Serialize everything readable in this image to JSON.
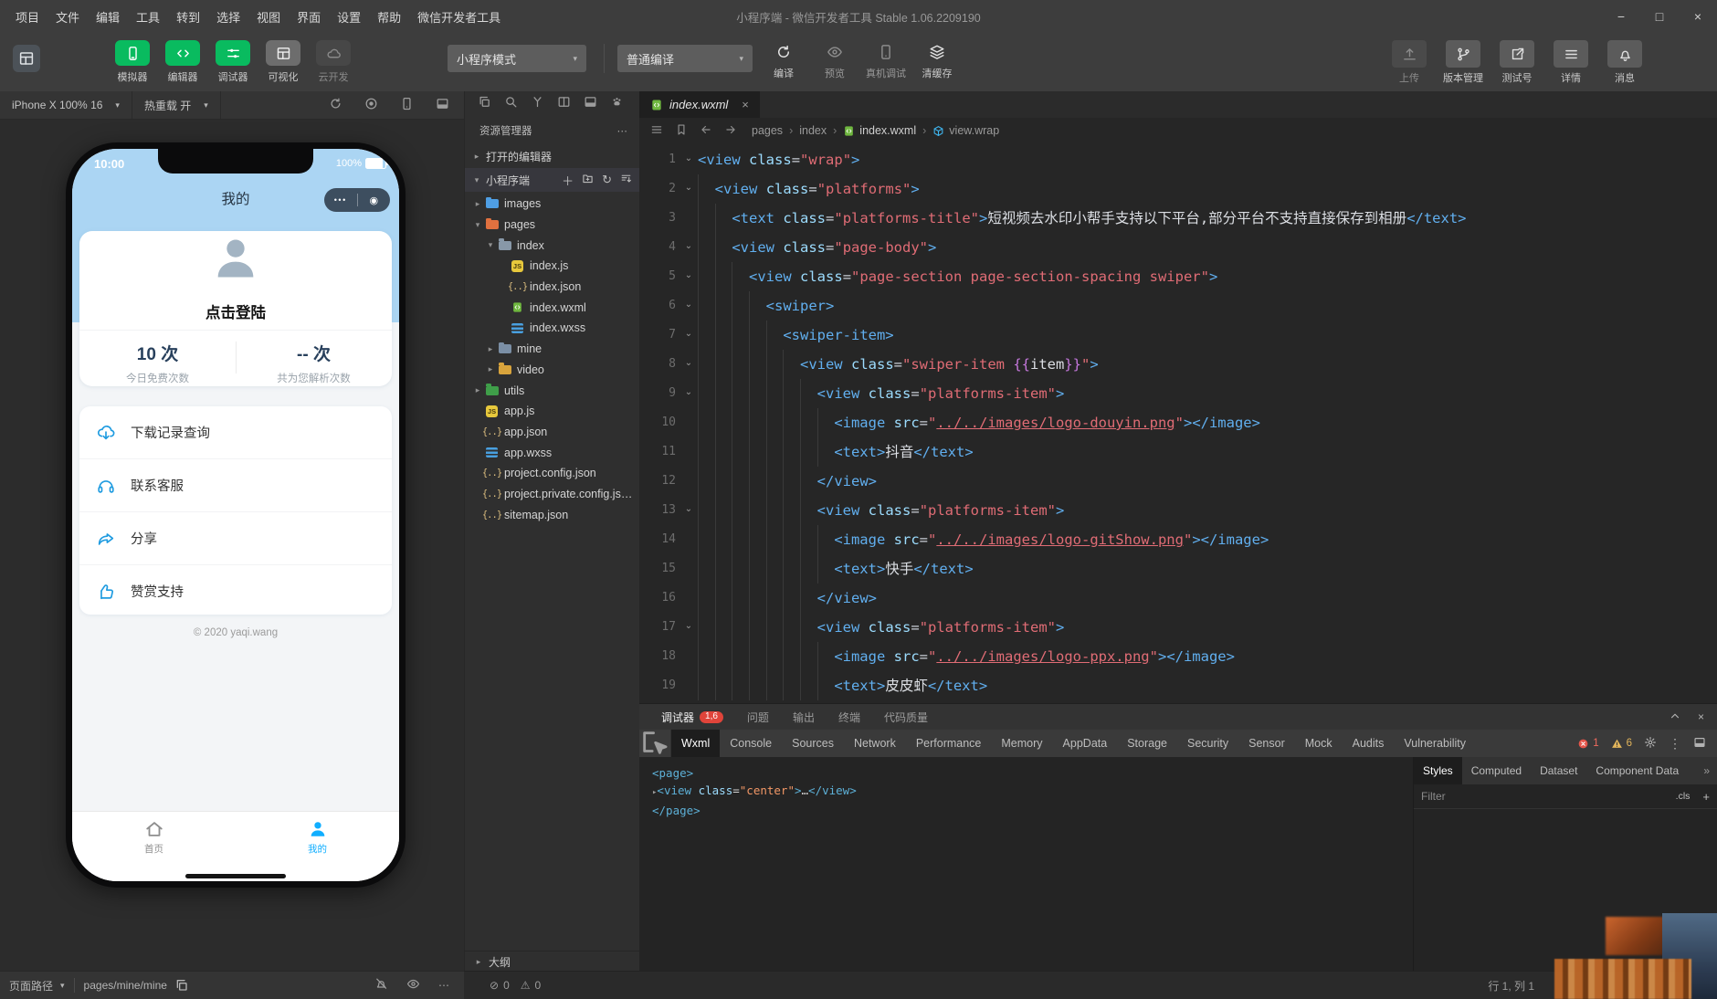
{
  "window": {
    "menu": [
      "项目",
      "文件",
      "编辑",
      "工具",
      "转到",
      "选择",
      "视图",
      "界面",
      "设置",
      "帮助",
      "微信开发者工具"
    ],
    "title": "小程序端 - 微信开发者工具 Stable 1.06.2209190",
    "controls": {
      "minimize": "−",
      "maximize": "□",
      "close": "×"
    }
  },
  "toolbar": {
    "toggles": [
      {
        "label": "模拟器",
        "icon": "phone",
        "state": "on"
      },
      {
        "label": "编辑器",
        "icon": "code",
        "state": "on"
      },
      {
        "label": "调试器",
        "icon": "sliders",
        "state": "on"
      },
      {
        "label": "可视化",
        "icon": "grid",
        "state": "neutral"
      },
      {
        "label": "云开发",
        "icon": "cloud",
        "state": "dim"
      }
    ],
    "mode_select": "小程序模式",
    "compile_select": "普通编译",
    "actions": [
      {
        "label": "编译",
        "icon": "refresh",
        "dim": false
      },
      {
        "label": "预览",
        "icon": "eye",
        "dim": true
      },
      {
        "label": "真机调试",
        "icon": "device",
        "dim": true
      },
      {
        "label": "清缓存",
        "icon": "stack",
        "dim": false
      }
    ],
    "right_actions": [
      {
        "label": "上传",
        "icon": "upload",
        "dim": true
      },
      {
        "label": "版本管理",
        "icon": "branch",
        "dim": false
      },
      {
        "label": "测试号",
        "icon": "external",
        "dim": false
      },
      {
        "label": "详情",
        "icon": "bars",
        "dim": false
      },
      {
        "label": "消息",
        "icon": "bell",
        "dim": false
      }
    ],
    "accent_green": "#09bb5f"
  },
  "simulator": {
    "bar": {
      "device": "iPhone X 100% 16",
      "hot_reload": "热重载 开"
    },
    "statusbar": {
      "time": "10:00",
      "battery": "100%"
    },
    "nav_title": "我的",
    "capsule": {
      "dots": "•••",
      "circle": "◉"
    },
    "profile": {
      "login": "点击登陆"
    },
    "stats": [
      {
        "value": "10 次",
        "label": "今日免费次数"
      },
      {
        "value": "-- 次",
        "label": "共为您解析次数"
      }
    ],
    "menu": [
      {
        "icon": "clouddown",
        "label": "下载记录查询"
      },
      {
        "icon": "headset",
        "label": "联系客服"
      },
      {
        "icon": "share",
        "label": "分享"
      },
      {
        "icon": "thumb",
        "label": "赞赏支持"
      }
    ],
    "copyright": "© 2020 yaqi.wang",
    "tabbar": [
      {
        "icon": "home",
        "label": "首页",
        "active": false
      },
      {
        "icon": "person",
        "label": "我的",
        "active": true
      }
    ],
    "footer": {
      "path_label": "页面路径",
      "path": "pages/mine/mine"
    },
    "accent_blue": "#10aeff"
  },
  "explorer": {
    "title": "资源管理器",
    "sections": [
      {
        "label": "打开的编辑器",
        "expanded": false
      },
      {
        "label": "小程序端",
        "expanded": true
      }
    ],
    "tree": [
      {
        "name": "images",
        "icon": "folder-images",
        "level": 1,
        "arrow": "right"
      },
      {
        "name": "pages",
        "icon": "folder-pages",
        "level": 1,
        "arrow": "down"
      },
      {
        "name": "index",
        "icon": "folder-open",
        "level": 2,
        "arrow": "down"
      },
      {
        "name": "index.js",
        "icon": "js",
        "level": 3,
        "arrow": ""
      },
      {
        "name": "index.json",
        "icon": "json",
        "level": 3,
        "arrow": ""
      },
      {
        "name": "index.wxml",
        "icon": "wxml",
        "level": 3,
        "arrow": ""
      },
      {
        "name": "index.wxss",
        "icon": "wxss",
        "level": 3,
        "arrow": ""
      },
      {
        "name": "mine",
        "icon": "folder",
        "level": 2,
        "arrow": "right"
      },
      {
        "name": "video",
        "icon": "folder-video",
        "level": 2,
        "arrow": "right"
      },
      {
        "name": "utils",
        "icon": "folder-utils",
        "level": 1,
        "arrow": "right"
      },
      {
        "name": "app.js",
        "icon": "js",
        "level": 1,
        "arrow": ""
      },
      {
        "name": "app.json",
        "icon": "json",
        "level": 1,
        "arrow": ""
      },
      {
        "name": "app.wxss",
        "icon": "wxss",
        "level": 1,
        "arrow": ""
      },
      {
        "name": "project.config.json",
        "icon": "json",
        "level": 1,
        "arrow": ""
      },
      {
        "name": "project.private.config.js…",
        "icon": "json",
        "level": 1,
        "arrow": ""
      },
      {
        "name": "sitemap.json",
        "icon": "json",
        "level": 1,
        "arrow": ""
      }
    ],
    "outline": "大纲"
  },
  "editor": {
    "tab": "index.wxml",
    "breadcrumb": [
      {
        "label": "pages",
        "icon": ""
      },
      {
        "label": "index",
        "icon": ""
      },
      {
        "label": "index.wxml",
        "icon": "wxmlfile"
      },
      {
        "label": "view.wrap",
        "icon": "cube"
      }
    ],
    "lines": [
      {
        "n": 1,
        "ind": 0,
        "fold": true,
        "tk": [
          [
            "t",
            "<view"
          ],
          [
            "o",
            " "
          ],
          [
            "a",
            "class"
          ],
          [
            "o",
            "="
          ],
          [
            "s",
            "\"wrap\""
          ],
          [
            "t",
            ">"
          ]
        ]
      },
      {
        "n": 2,
        "ind": 1,
        "fold": true,
        "tk": [
          [
            "t",
            "<view"
          ],
          [
            "o",
            " "
          ],
          [
            "a",
            "class"
          ],
          [
            "o",
            "="
          ],
          [
            "s",
            "\"platforms\""
          ],
          [
            "t",
            ">"
          ]
        ]
      },
      {
        "n": 3,
        "ind": 2,
        "fold": false,
        "tk": [
          [
            "t",
            "<text"
          ],
          [
            "o",
            " "
          ],
          [
            "a",
            "class"
          ],
          [
            "o",
            "="
          ],
          [
            "s",
            "\"platforms-title\""
          ],
          [
            "t",
            ">"
          ],
          [
            "x",
            "短视频去水印小帮手支持以下平台,部分平台不支持直接保存到相册"
          ],
          [
            "t",
            "</text>"
          ]
        ]
      },
      {
        "n": 4,
        "ind": 2,
        "fold": true,
        "tk": [
          [
            "t",
            "<view"
          ],
          [
            "o",
            " "
          ],
          [
            "a",
            "class"
          ],
          [
            "o",
            "="
          ],
          [
            "s",
            "\"page-body\""
          ],
          [
            "t",
            ">"
          ]
        ]
      },
      {
        "n": 5,
        "ind": 3,
        "fold": true,
        "tk": [
          [
            "t",
            "<view"
          ],
          [
            "o",
            " "
          ],
          [
            "a",
            "class"
          ],
          [
            "o",
            "="
          ],
          [
            "s",
            "\"page-section page-section-spacing swiper\""
          ],
          [
            "t",
            ">"
          ]
        ]
      },
      {
        "n": 6,
        "ind": 4,
        "fold": true,
        "tk": [
          [
            "t",
            "<swiper>"
          ]
        ]
      },
      {
        "n": 7,
        "ind": 5,
        "fold": true,
        "tk": [
          [
            "t",
            "<swiper-item>"
          ]
        ]
      },
      {
        "n": 8,
        "ind": 6,
        "fold": true,
        "tk": [
          [
            "t",
            "<view"
          ],
          [
            "o",
            " "
          ],
          [
            "a",
            "class"
          ],
          [
            "o",
            "="
          ],
          [
            "s",
            "\"swiper-item "
          ],
          [
            "b",
            "{{"
          ],
          [
            "x",
            "item"
          ],
          [
            "b",
            "}}"
          ],
          [
            "s",
            "\""
          ],
          [
            "t",
            ">"
          ]
        ]
      },
      {
        "n": 9,
        "ind": 7,
        "fold": true,
        "tk": [
          [
            "t",
            "<view"
          ],
          [
            "o",
            " "
          ],
          [
            "a",
            "class"
          ],
          [
            "o",
            "="
          ],
          [
            "s",
            "\"platforms-item\""
          ],
          [
            "t",
            ">"
          ]
        ]
      },
      {
        "n": 10,
        "ind": 8,
        "fold": false,
        "tk": [
          [
            "t",
            "<image"
          ],
          [
            "o",
            " "
          ],
          [
            "a",
            "src"
          ],
          [
            "o",
            "="
          ],
          [
            "s",
            "\""
          ],
          [
            "u",
            "../../images/logo-douyin.png"
          ],
          [
            "s",
            "\""
          ],
          [
            "t",
            "></image>"
          ]
        ]
      },
      {
        "n": 11,
        "ind": 8,
        "fold": false,
        "tk": [
          [
            "t",
            "<text>"
          ],
          [
            "x",
            "抖音"
          ],
          [
            "t",
            "</text>"
          ]
        ]
      },
      {
        "n": 12,
        "ind": 7,
        "fold": false,
        "tk": [
          [
            "t",
            "</view>"
          ]
        ]
      },
      {
        "n": 13,
        "ind": 7,
        "fold": true,
        "tk": [
          [
            "t",
            "<view"
          ],
          [
            "o",
            " "
          ],
          [
            "a",
            "class"
          ],
          [
            "o",
            "="
          ],
          [
            "s",
            "\"platforms-item\""
          ],
          [
            "t",
            ">"
          ]
        ]
      },
      {
        "n": 14,
        "ind": 8,
        "fold": false,
        "tk": [
          [
            "t",
            "<image"
          ],
          [
            "o",
            " "
          ],
          [
            "a",
            "src"
          ],
          [
            "o",
            "="
          ],
          [
            "s",
            "\""
          ],
          [
            "u",
            "../../images/logo-gitShow.png"
          ],
          [
            "s",
            "\""
          ],
          [
            "t",
            "></image>"
          ]
        ]
      },
      {
        "n": 15,
        "ind": 8,
        "fold": false,
        "tk": [
          [
            "t",
            "<text>"
          ],
          [
            "x",
            "快手"
          ],
          [
            "t",
            "</text>"
          ]
        ]
      },
      {
        "n": 16,
        "ind": 7,
        "fold": false,
        "tk": [
          [
            "t",
            "</view>"
          ]
        ]
      },
      {
        "n": 17,
        "ind": 7,
        "fold": true,
        "tk": [
          [
            "t",
            "<view"
          ],
          [
            "o",
            " "
          ],
          [
            "a",
            "class"
          ],
          [
            "o",
            "="
          ],
          [
            "s",
            "\"platforms-item\""
          ],
          [
            "t",
            ">"
          ]
        ]
      },
      {
        "n": 18,
        "ind": 8,
        "fold": false,
        "tk": [
          [
            "t",
            "<image"
          ],
          [
            "o",
            " "
          ],
          [
            "a",
            "src"
          ],
          [
            "o",
            "="
          ],
          [
            "s",
            "\""
          ],
          [
            "u",
            "../../images/logo-ppx.png"
          ],
          [
            "s",
            "\""
          ],
          [
            "t",
            "></image>"
          ]
        ]
      },
      {
        "n": 19,
        "ind": 8,
        "fold": false,
        "tk": [
          [
            "t",
            "<text>"
          ],
          [
            "x",
            "皮皮虾"
          ],
          [
            "t",
            "</text>"
          ]
        ]
      }
    ]
  },
  "debugger": {
    "bar_tabs": [
      "调试器",
      "问题",
      "输出",
      "终端",
      "代码质量"
    ],
    "badge": "1,6",
    "devtools_tabs": [
      "Wxml",
      "Console",
      "Sources",
      "Network",
      "Performance",
      "Memory",
      "AppData",
      "Storage",
      "Security",
      "Sensor",
      "Mock",
      "Audits",
      "Vulnerability"
    ],
    "active_tab": "Wxml",
    "error_count": "1",
    "warn_count": "6",
    "wxml_tree": [
      {
        "arrow": false,
        "tk": [
          [
            "wt",
            "<page>"
          ]
        ]
      },
      {
        "arrow": true,
        "tk": [
          [
            "wt",
            "<view"
          ],
          [
            "wo",
            " "
          ],
          [
            "wa",
            "class"
          ],
          [
            "wo",
            "="
          ],
          [
            "ws",
            "\"center\""
          ],
          [
            "wt",
            ">"
          ],
          [
            "wo",
            "…"
          ],
          [
            "wt",
            "</view>"
          ]
        ]
      },
      {
        "arrow": false,
        "tk": [
          [
            "wt",
            "</page>"
          ]
        ]
      }
    ],
    "styles_tabs": [
      "Styles",
      "Computed",
      "Dataset",
      "Component Data"
    ],
    "styles_more": "»",
    "filter_placeholder": "Filter",
    "cls_label": ".cls"
  },
  "statusbar": {
    "problems_err": "0",
    "problems_warn": "0",
    "cursor": "行 1, 列 1"
  }
}
